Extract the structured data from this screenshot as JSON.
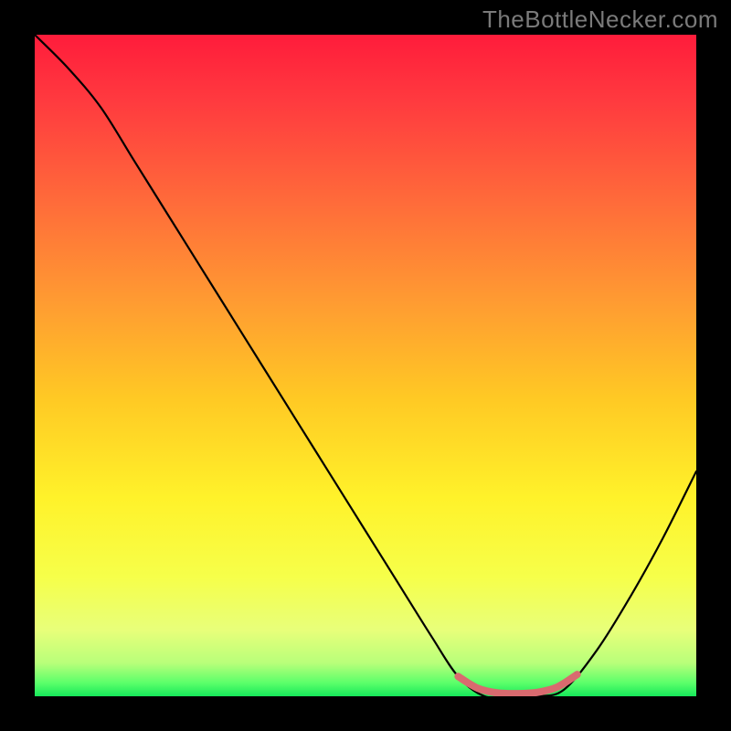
{
  "watermark": "TheBottleNecker.com",
  "chart_data": {
    "type": "line",
    "title": "",
    "xlabel": "",
    "ylabel": "",
    "xlim": [
      0,
      1
    ],
    "ylim": [
      0,
      1
    ],
    "legend": false,
    "grid": false,
    "background": "rainbow-vertical",
    "series": [
      {
        "name": "bottleneck-curve",
        "x": [
          0.0,
          0.05,
          0.1,
          0.15,
          0.2,
          0.25,
          0.3,
          0.35,
          0.4,
          0.45,
          0.5,
          0.55,
          0.6,
          0.64,
          0.68,
          0.72,
          0.76,
          0.8,
          0.85,
          0.9,
          0.95,
          1.0
        ],
        "y": [
          1.0,
          0.95,
          0.89,
          0.81,
          0.73,
          0.65,
          0.57,
          0.49,
          0.41,
          0.33,
          0.25,
          0.17,
          0.09,
          0.03,
          0.0,
          0.0,
          0.0,
          0.01,
          0.07,
          0.15,
          0.24,
          0.34
        ]
      }
    ],
    "highlight": {
      "name": "valley-highlight",
      "x": [
        0.64,
        0.67,
        0.7,
        0.73,
        0.76,
        0.79,
        0.82
      ],
      "y": [
        0.03,
        0.012,
        0.005,
        0.004,
        0.006,
        0.014,
        0.033
      ],
      "color": "#d96a6f"
    },
    "gradient_stops": [
      {
        "offset": 0.0,
        "color": "#ff1c3b"
      },
      {
        "offset": 0.1,
        "color": "#ff3a3f"
      },
      {
        "offset": 0.25,
        "color": "#ff6a3a"
      },
      {
        "offset": 0.4,
        "color": "#ff9a32"
      },
      {
        "offset": 0.55,
        "color": "#ffc924"
      },
      {
        "offset": 0.7,
        "color": "#fff22a"
      },
      {
        "offset": 0.82,
        "color": "#f6ff4a"
      },
      {
        "offset": 0.9,
        "color": "#e8ff7a"
      },
      {
        "offset": 0.95,
        "color": "#b8ff7a"
      },
      {
        "offset": 0.98,
        "color": "#5bff6a"
      },
      {
        "offset": 1.0,
        "color": "#16e85a"
      }
    ]
  }
}
